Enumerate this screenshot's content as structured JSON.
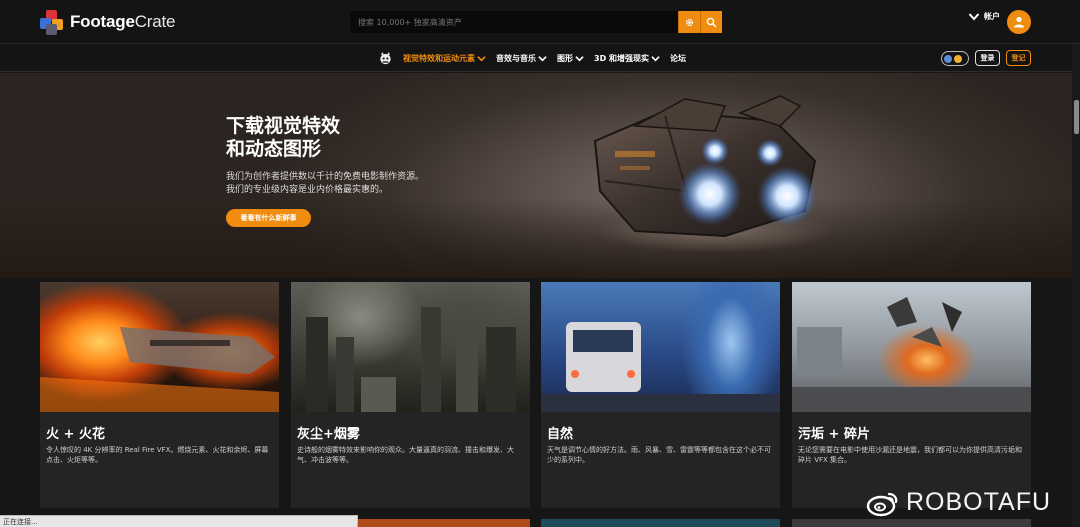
{
  "header": {
    "logo_brand_bold": "Footage",
    "logo_brand_light": "Crate",
    "search_placeholder": "搜索 10,000+ 独家高清资产",
    "account_label": "帐户"
  },
  "nav": {
    "items": [
      {
        "label": "视觉特效和运动元素",
        "active": true,
        "dropdown": true
      },
      {
        "label": "音效与音乐",
        "active": false,
        "dropdown": true
      },
      {
        "label": "图形",
        "active": false,
        "dropdown": true
      },
      {
        "label": "3D 和增强现实",
        "active": false,
        "dropdown": true
      },
      {
        "label": "论坛",
        "active": false,
        "dropdown": false
      }
    ],
    "login_label": "登录",
    "register_label": "登记"
  },
  "hero": {
    "title": "下载视觉特效\n和动态图形",
    "description": "我们为创作者提供数以千计的免费电影制作资源。\n我们的专业级内容是业内价格最实惠的。",
    "cta_label": "看看有什么新鲜事"
  },
  "cards": [
    {
      "title": "火 + 火花",
      "description": "令人惊叹的 4K 分辨率的 Real Fire VFX。燃烧元素、火花和余烬、屏幕点击、火炬等等。"
    },
    {
      "title": "灰尘+烟雾",
      "description": "史诗般的烟雾特效来影响你的观众。大量逼真的羽流、撞击和爆发、大气、冲击波等等。"
    },
    {
      "title": "自然",
      "description": "天气是调节心情的好方法。雨、风暴、雪、雷霆等等都包含在这个必不可少的系列中。"
    },
    {
      "title": "污垢 + 碎片",
      "description": "无论您需要在电影中使用沙漏还是地震，我们都可以为你提供高清污垢和碎片 VFX 集合。"
    }
  ],
  "status_bar": "正在连接...",
  "watermark": "ROBOTAFU",
  "colors": {
    "accent": "#f08c10",
    "background": "#161616",
    "card": "#242424"
  }
}
